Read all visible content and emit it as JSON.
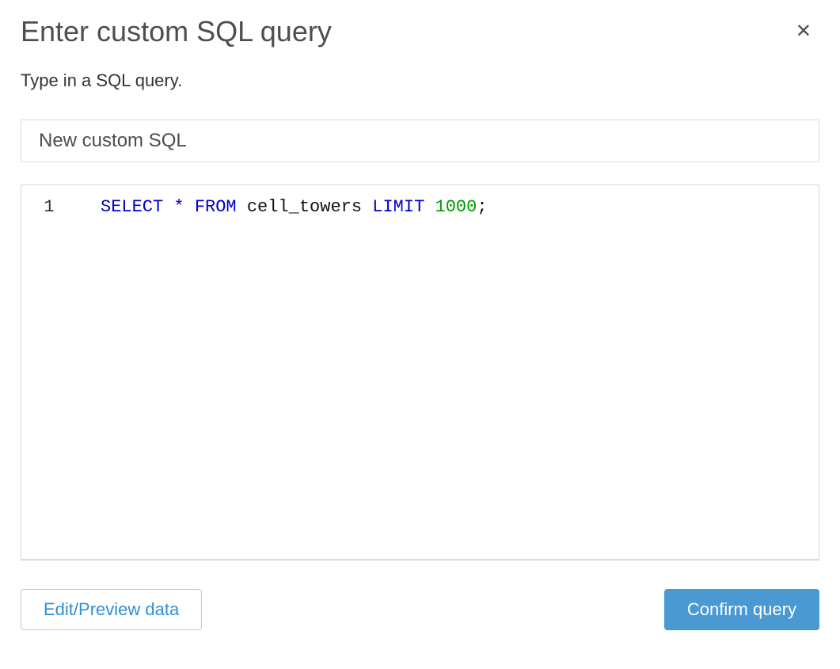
{
  "dialog": {
    "title": "Enter custom SQL query",
    "subtitle": "Type in a SQL query."
  },
  "name_field": {
    "value": "New custom SQL"
  },
  "editor": {
    "lines": [
      {
        "num": "1"
      }
    ],
    "sql": {
      "kw_select": "SELECT",
      "star": "*",
      "kw_from": "FROM",
      "table": "cell_towers",
      "kw_limit": "LIMIT",
      "limit_val": "1000",
      "semicolon": ";"
    }
  },
  "buttons": {
    "edit_preview": "Edit/Preview data",
    "confirm": "Confirm query"
  }
}
